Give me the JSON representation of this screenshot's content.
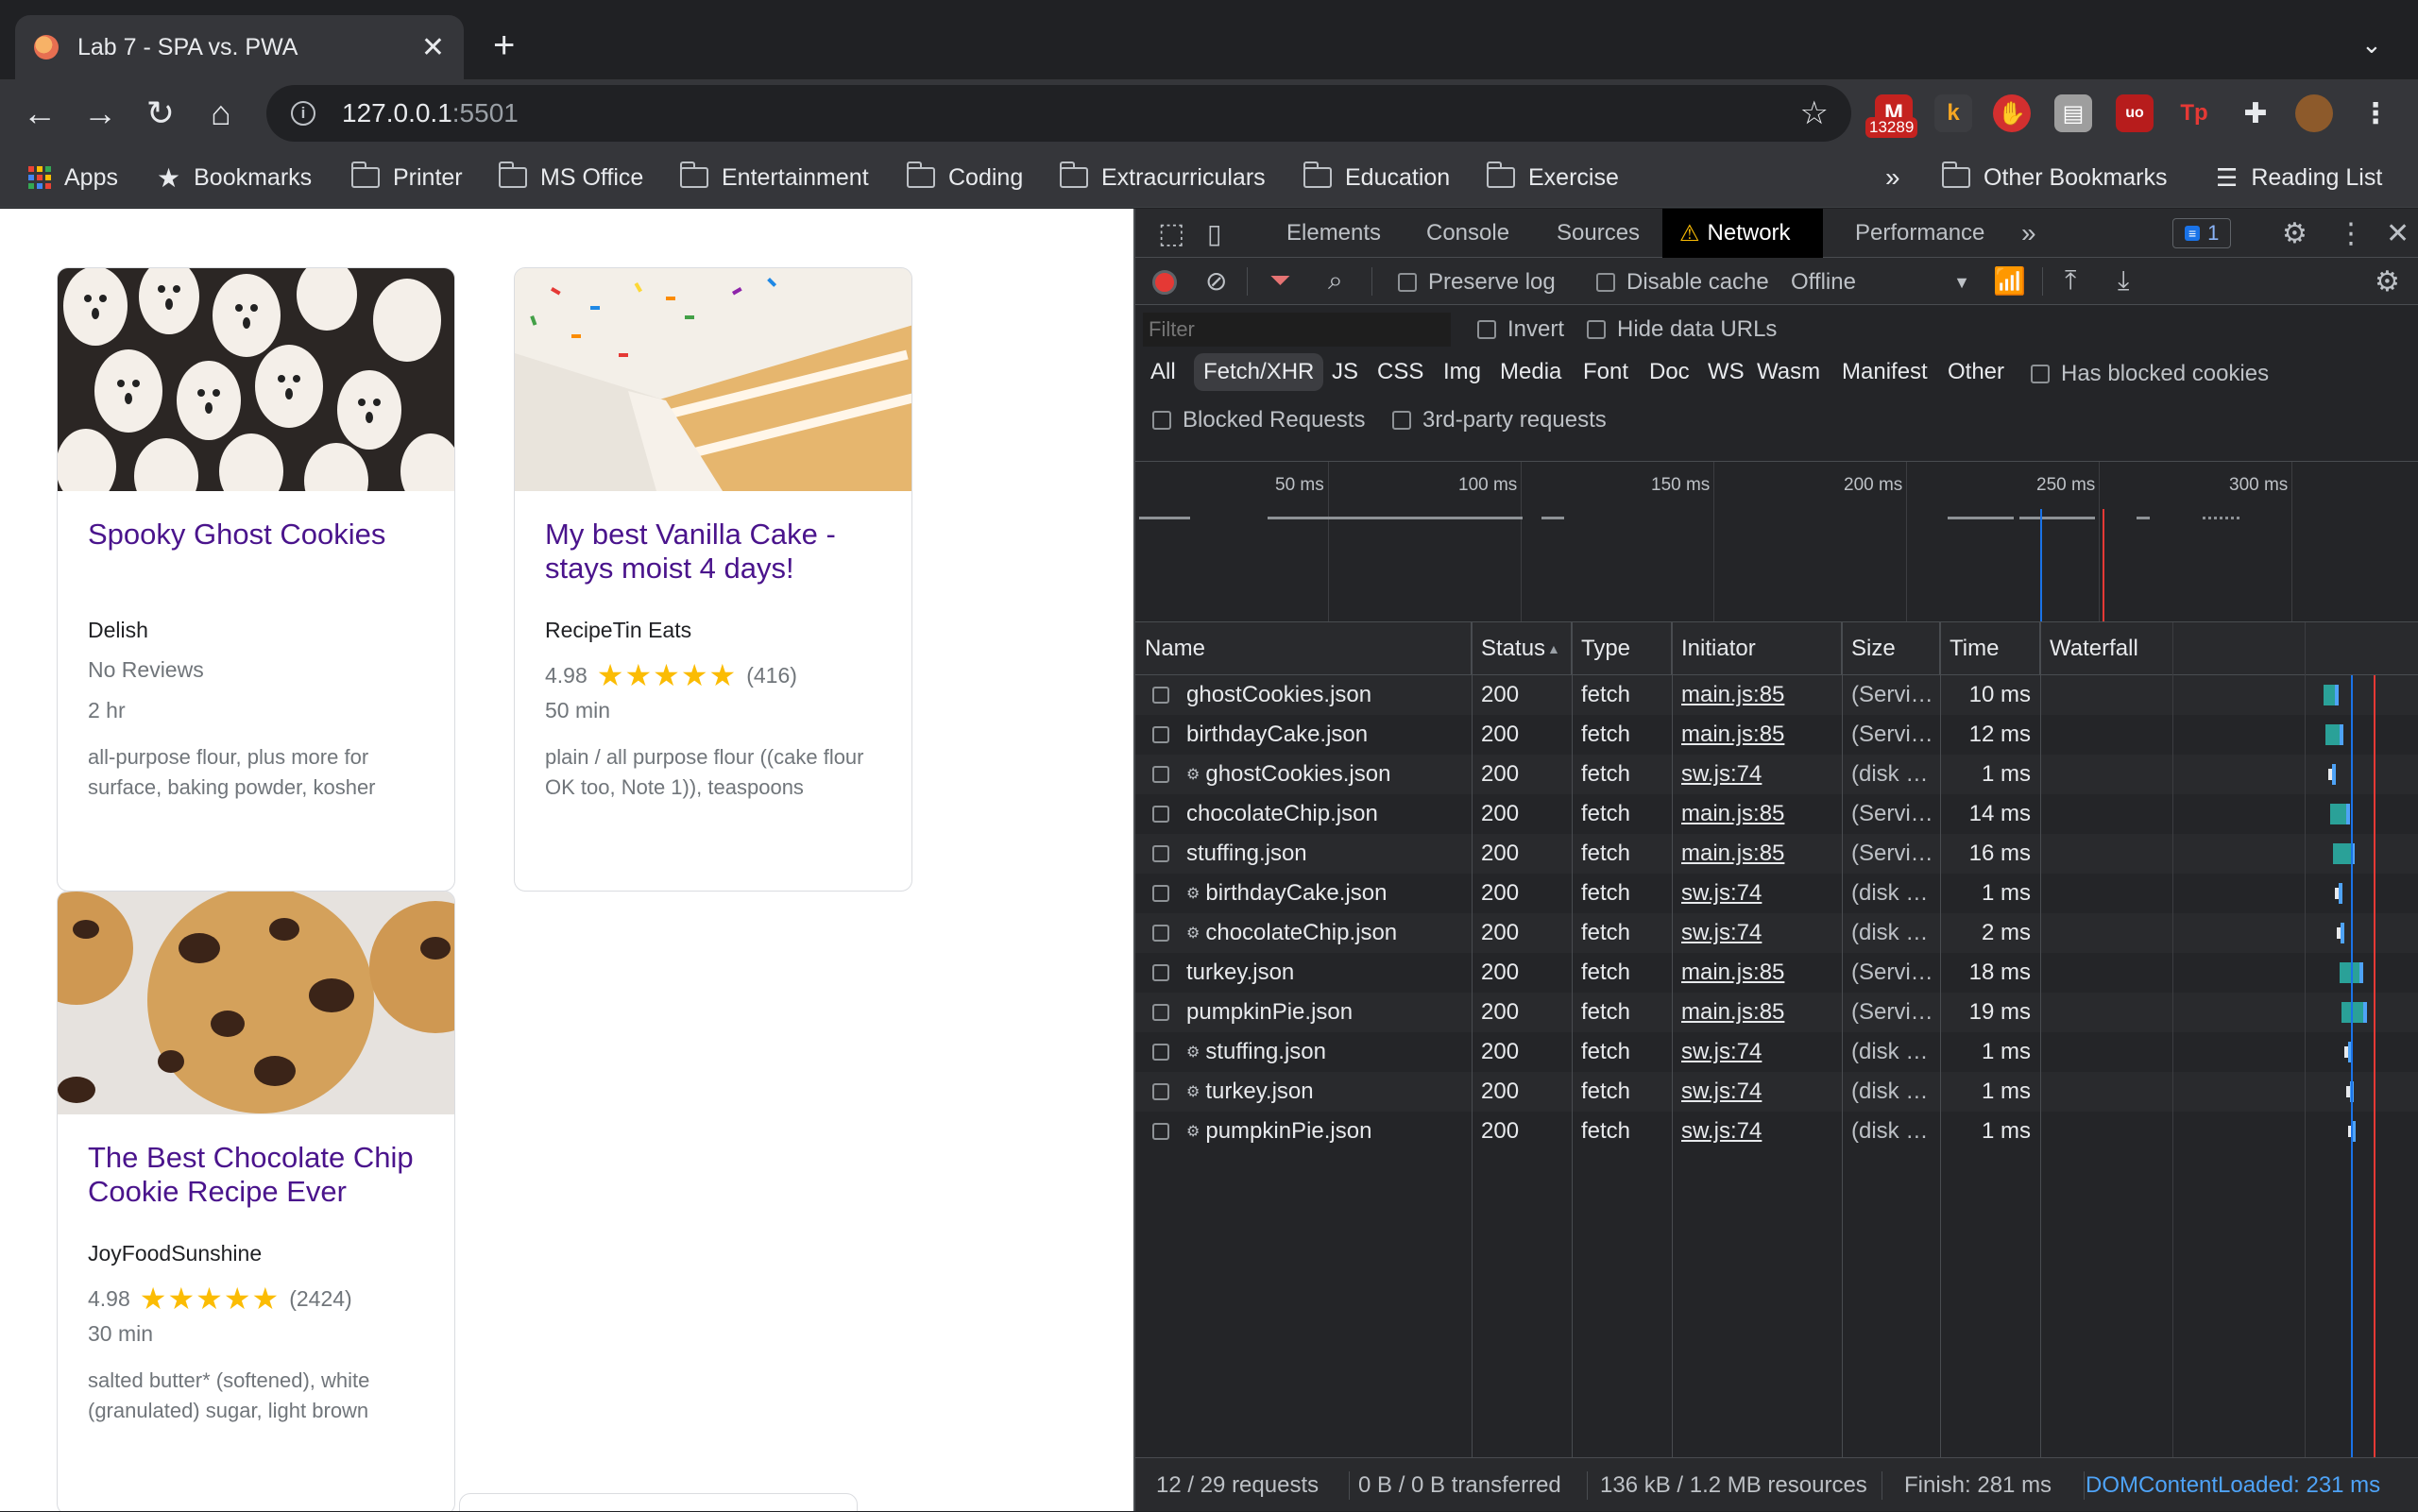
{
  "browser": {
    "tab_title": "Lab 7 - SPA vs. PWA",
    "url_host": "127.0.0.1",
    "url_port": ":5501",
    "ext_badge": "13289"
  },
  "bookmarks": {
    "apps": "Apps",
    "bookmarks": "Bookmarks",
    "folders": [
      "Printer",
      "MS Office",
      "Entertainment",
      "Coding",
      "Extracurriculars",
      "Education",
      "Exercise"
    ],
    "overflow": "»",
    "other": "Other Bookmarks",
    "reading_list": "Reading List"
  },
  "recipes": [
    {
      "title": "Spooky Ghost Cookies",
      "source": "Delish",
      "rating": "",
      "stars": "",
      "count": "",
      "no_reviews": "No Reviews",
      "time": "2 hr",
      "ingredients": "all-purpose flour, plus more for surface, baking powder, kosher"
    },
    {
      "title": "My best Vanilla Cake - stays moist 4 days!",
      "source": "RecipeTin Eats",
      "rating": "4.98",
      "stars": "★★★★★",
      "count": "(416)",
      "time": "50 min",
      "ingredients": "plain / all purpose flour ((cake flour OK too, Note 1)), teaspoons"
    },
    {
      "title": "The Best Chocolate Chip Cookie Recipe Ever",
      "source": "JoyFoodSunshine",
      "rating": "4.98",
      "stars": "★★★★★",
      "count": "(2424)",
      "time": "30 min",
      "ingredients": "salted butter* (softened), white (granulated) sugar, light brown"
    }
  ],
  "devtools": {
    "tabs": [
      "Elements",
      "Console",
      "Sources",
      "Network",
      "Performance"
    ],
    "more_tabs": "»",
    "issues_count": "1",
    "preserve_log": "Preserve log",
    "disable_cache": "Disable cache",
    "throttle": "Offline",
    "filter_placeholder": "Filter",
    "invert": "Invert",
    "hide_data_urls": "Hide data URLs",
    "types": [
      "All",
      "Fetch/XHR",
      "JS",
      "CSS",
      "Img",
      "Media",
      "Font",
      "Doc",
      "WS",
      "Wasm",
      "Manifest",
      "Other"
    ],
    "has_blocked_cookies": "Has blocked cookies",
    "blocked_requests": "Blocked Requests",
    "third_party": "3rd-party requests",
    "ticks": [
      "50 ms",
      "100 ms",
      "150 ms",
      "200 ms",
      "250 ms",
      "300 ms"
    ],
    "columns": [
      "Name",
      "Status",
      "Type",
      "Initiator",
      "Size",
      "Time",
      "Waterfall"
    ],
    "sort_indicator": "▲",
    "rows": [
      {
        "name": "ghostCookies.json",
        "sw": false,
        "status": "200",
        "type": "fetch",
        "initiator": "main.js:85",
        "size": "(Servi…",
        "time": "10 ms"
      },
      {
        "name": "birthdayCake.json",
        "sw": false,
        "status": "200",
        "type": "fetch",
        "initiator": "main.js:85",
        "size": "(Servi…",
        "time": "12 ms"
      },
      {
        "name": "ghostCookies.json",
        "sw": true,
        "status": "200",
        "type": "fetch",
        "initiator": "sw.js:74",
        "size": "(disk …",
        "time": "1 ms"
      },
      {
        "name": "chocolateChip.json",
        "sw": false,
        "status": "200",
        "type": "fetch",
        "initiator": "main.js:85",
        "size": "(Servi…",
        "time": "14 ms"
      },
      {
        "name": "stuffing.json",
        "sw": false,
        "status": "200",
        "type": "fetch",
        "initiator": "main.js:85",
        "size": "(Servi…",
        "time": "16 ms"
      },
      {
        "name": "birthdayCake.json",
        "sw": true,
        "status": "200",
        "type": "fetch",
        "initiator": "sw.js:74",
        "size": "(disk …",
        "time": "1 ms"
      },
      {
        "name": "chocolateChip.json",
        "sw": true,
        "status": "200",
        "type": "fetch",
        "initiator": "sw.js:74",
        "size": "(disk …",
        "time": "2 ms"
      },
      {
        "name": "turkey.json",
        "sw": false,
        "status": "200",
        "type": "fetch",
        "initiator": "main.js:85",
        "size": "(Servi…",
        "time": "18 ms"
      },
      {
        "name": "pumpkinPie.json",
        "sw": false,
        "status": "200",
        "type": "fetch",
        "initiator": "main.js:85",
        "size": "(Servi…",
        "time": "19 ms"
      },
      {
        "name": "stuffing.json",
        "sw": true,
        "status": "200",
        "type": "fetch",
        "initiator": "sw.js:74",
        "size": "(disk …",
        "time": "1 ms"
      },
      {
        "name": "turkey.json",
        "sw": true,
        "status": "200",
        "type": "fetch",
        "initiator": "sw.js:74",
        "size": "(disk …",
        "time": "1 ms"
      },
      {
        "name": "pumpkinPie.json",
        "sw": true,
        "status": "200",
        "type": "fetch",
        "initiator": "sw.js:74",
        "size": "(disk …",
        "time": "1 ms"
      }
    ],
    "status_bar": {
      "requests": "12 / 29 requests",
      "transferred": "0 B / 0 B transferred",
      "resources": "136 kB / 1.2 MB resources",
      "finish": "Finish: 281 ms",
      "dcl": "DOMContentLoaded: 231 ms"
    },
    "colors": {
      "accent": "#8ab4f8",
      "teal": "#2aa198",
      "dcl": "#1a73e8",
      "load": "#e53935"
    }
  }
}
